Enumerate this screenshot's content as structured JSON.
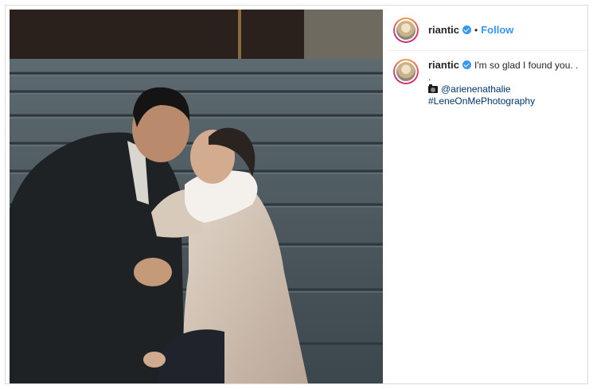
{
  "post": {
    "username": "riantic",
    "follow_label": "Follow",
    "separator": "•",
    "caption": {
      "username": "riantic",
      "text": "I'm so glad I found you. .",
      "dot_line": ".",
      "mention": "@arienenathalie",
      "hashtag": "#LeneOnMePhotography"
    }
  },
  "icons": {
    "verified": "verified-badge-icon",
    "camera": "camera-icon"
  },
  "colors": {
    "link_blue": "#3897f0",
    "hashtag_blue": "#003569",
    "text": "#262626",
    "border": "#dbdbdb"
  }
}
